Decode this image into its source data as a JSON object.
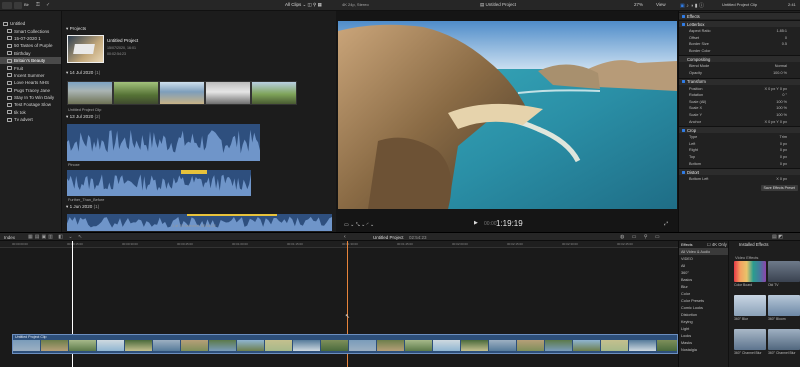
{
  "colors": {
    "accent": "#2f7ce6",
    "wave": "#2e4f7e",
    "playhead": "#ffffff",
    "skimmer": "#e7843b",
    "selected": "#4a4a4a"
  },
  "topbar": {
    "app_label": "Blr",
    "clips_filter": "All Clips",
    "viewer_info": "4K 24p, Stereo",
    "project_name": "Untitled Project",
    "zoom": "27%",
    "view_label": "View",
    "inspector_title": "Untitled Project Clip",
    "inspector_time": "2:41"
  },
  "library": {
    "items": [
      {
        "label": "Untitled",
        "icon": "library-icon",
        "indent": 0
      },
      {
        "label": "Smart Collections",
        "icon": "folder-icon",
        "indent": 1
      },
      {
        "label": "15-07-2020 1",
        "icon": "event-icon",
        "indent": 1
      },
      {
        "label": "50 Tastes of Purple",
        "icon": "event-icon",
        "indent": 1
      },
      {
        "label": "Birthday",
        "icon": "event-icon",
        "indent": 1
      },
      {
        "label": "Britain's Beauty",
        "icon": "event-icon",
        "indent": 1,
        "selected": true
      },
      {
        "label": "Fruit",
        "icon": "event-icon",
        "indent": 1
      },
      {
        "label": "Incent Summer",
        "icon": "event-icon",
        "indent": 1
      },
      {
        "label": "Love Hearts NHS",
        "icon": "event-icon",
        "indent": 1
      },
      {
        "label": "Pugs Tracey Jane",
        "icon": "event-icon",
        "indent": 1
      },
      {
        "label": "Stay In To Win Daily",
        "icon": "event-icon",
        "indent": 1
      },
      {
        "label": "Test Footage Slow",
        "icon": "event-icon",
        "indent": 1
      },
      {
        "label": "tik tok",
        "icon": "event-icon",
        "indent": 1
      },
      {
        "label": "Tv advert",
        "icon": "event-icon",
        "indent": 1
      }
    ]
  },
  "browser": {
    "projects_heading": "Projects",
    "project": {
      "name": "Untitled Project",
      "date": "15/07/2020, 16:01",
      "duration": "00:02:54:23"
    },
    "groups": [
      {
        "label": "14 Jul 2020",
        "count": "(1)"
      },
      {
        "label": "13 Jul 2020",
        "count": "(2)"
      },
      {
        "label": "1 Jun 2020",
        "count": "(1)"
      }
    ],
    "clip_names": [
      "Untitled Project Clip",
      "Pinoxe",
      "Further_Than_Before"
    ],
    "status": "1 of 23 selected, 02:54:23"
  },
  "viewer": {
    "timecode": "1:19:19",
    "timecode_prefix": "00:00"
  },
  "inspector": {
    "effects_label": "Effects",
    "letterbox_label": "Letterbox",
    "letterbox_rows": [
      {
        "label": "Aspect Ratio",
        "value": "1.85:1"
      },
      {
        "label": "Offset",
        "value": "0"
      },
      {
        "label": "Border Size",
        "value": "0.5"
      },
      {
        "label": "Border Color",
        "value": ""
      }
    ],
    "compositing_label": "Compositing",
    "compositing_rows": [
      {
        "label": "Blend Mode",
        "value": "Normal"
      },
      {
        "label": "Opacity",
        "value": "100.0 %"
      }
    ],
    "transform_label": "Transform",
    "transform_rows": [
      {
        "label": "Position",
        "value": "X 0 px  Y 0 px"
      },
      {
        "label": "Rotation",
        "value": "0 °"
      },
      {
        "label": "Scale (All)",
        "value": "100 %"
      },
      {
        "label": "Scale X",
        "value": "100 %"
      },
      {
        "label": "Scale Y",
        "value": "100 %"
      },
      {
        "label": "Anchor",
        "value": "X 0 px  Y 0 px"
      }
    ],
    "crop_label": "Crop",
    "crop_rows": [
      {
        "label": "Type",
        "value": "Trim"
      },
      {
        "label": "Left",
        "value": "0 px"
      },
      {
        "label": "Right",
        "value": "0 px"
      },
      {
        "label": "Top",
        "value": "0 px"
      },
      {
        "label": "Bottom",
        "value": "0 px"
      }
    ],
    "distort_label": "Distort",
    "distort_rows": [
      {
        "label": "Bottom Left",
        "value": "X 0 px"
      }
    ],
    "save_preset": "Save Effects Preset"
  },
  "timeline_bar": {
    "index": "Index",
    "project": "Untitled Project",
    "duration": "02:54:23"
  },
  "timeline": {
    "clip_label": "Untitled Project Clip",
    "ruler": [
      "00:00:00:00",
      "00:00:15:00",
      "00:00:30:00",
      "00:00:45:00",
      "00:01:00:00",
      "00:01:15:00",
      "00:01:30:00",
      "00:01:45:00",
      "00:02:00:00",
      "00:02:15:00",
      "00:02:30:00",
      "00:02:45:00"
    ]
  },
  "effects_browser": {
    "tabs": [
      "4K Only",
      "Installed Effects"
    ],
    "categories": [
      "Effects",
      "All Video & Audio",
      "VIDEO",
      "All",
      "360°",
      "Basics",
      "Blur",
      "Color",
      "Color Presets",
      "Comic Looks",
      "Distortion",
      "Keying",
      "Light",
      "Looks",
      "Masks",
      "Nostalgia"
    ],
    "section": "Video Effects",
    "items": [
      "Color Board",
      "Old TV",
      "360° Blur",
      "360° Bloom",
      "360° Channel Blur",
      "360° Channel Blur"
    ]
  }
}
